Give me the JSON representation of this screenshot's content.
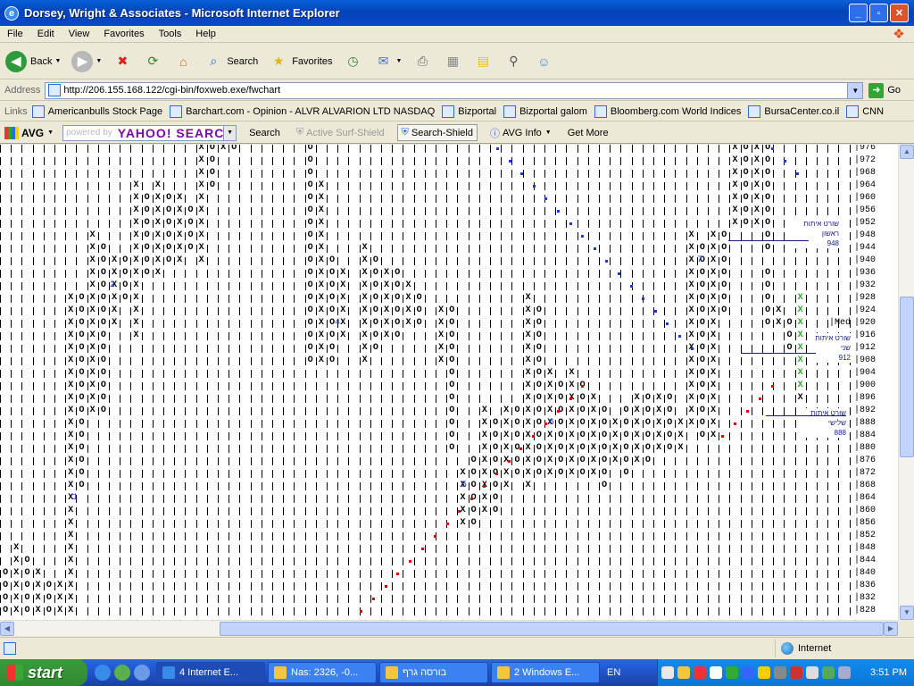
{
  "window": {
    "title": "Dorsey, Wright & Associates - Microsoft Internet Explorer"
  },
  "menu": [
    "File",
    "Edit",
    "View",
    "Favorites",
    "Tools",
    "Help"
  ],
  "toolbar": {
    "back": "Back",
    "search": "Search",
    "favorites": "Favorites"
  },
  "address": {
    "label": "Address",
    "url": "http://206.155.168.122/cgi-bin/foxweb.exe/fwchart",
    "go": "Go"
  },
  "links": {
    "label": "Links",
    "items": [
      "Americanbulls Stock Page",
      "Barchart.com - Opinion - ALVR ALVARION LTD NASDAQ",
      "Bizportal",
      "Bizportal galom",
      "Bloomberg.com World Indices",
      "BursaCenter.co.il",
      "CNN"
    ]
  },
  "avgbar": {
    "brand": "AVG",
    "yahoo_hint": "powered by",
    "yahoo_brand": "YAHOO! SEARCH",
    "search": "Search",
    "active_surf": "Active Surf-Shield",
    "search_shield": "Search-Shield",
    "avg_info": "AVG Info",
    "get_more": "Get More"
  },
  "chart_data": {
    "type": "table",
    "description": "point-and-figure",
    "box_levels": [
      976,
      972,
      968,
      964,
      960,
      956,
      952,
      948,
      944,
      940,
      936,
      932,
      928,
      924,
      920,
      916,
      912,
      908,
      904,
      900,
      896,
      892,
      888,
      884,
      880,
      876,
      872,
      868,
      864,
      860,
      856,
      852,
      848,
      844,
      840,
      836,
      832,
      828
    ],
    "annotations": [
      {
        "text": "שורט איתות ראשון",
        "value": "948"
      },
      {
        "text": "שורט איתות שני",
        "value": "912"
      },
      {
        "text": "שורט איתות שלישי",
        "value": "888"
      },
      {
        "text": "Med"
      }
    ],
    "box_marks": [
      "2",
      "4",
      "7",
      "1",
      "5",
      "6"
    ]
  },
  "statusbar": {
    "zone": "Internet"
  },
  "taskbar": {
    "start": "start",
    "tasks": [
      "4 Internet E...",
      "Nas: 2326, -0...",
      "בורסה גרף",
      "2 Windows E..."
    ],
    "lang": "EN",
    "time": "3:51 PM"
  },
  "colors": {
    "x": "#000000",
    "o": "#000000",
    "trend_red": "#e00000",
    "trend_blue": "#1d3bcc",
    "signal_green": "#22aa22"
  }
}
